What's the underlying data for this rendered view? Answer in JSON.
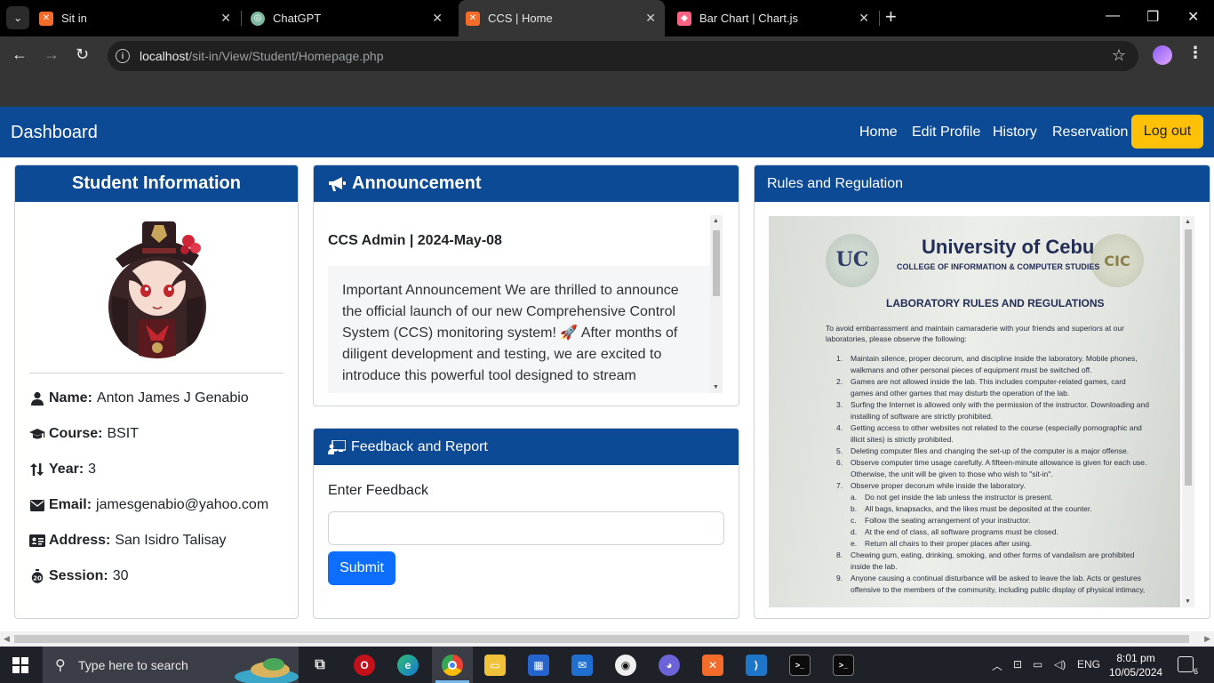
{
  "browser": {
    "tabs": [
      {
        "title": "Sit in",
        "active": false,
        "favicon": "xampp-icon"
      },
      {
        "title": "ChatGPT",
        "active": false,
        "favicon": "chatgpt-icon"
      },
      {
        "title": "CCS | Home",
        "active": true,
        "favicon": "xampp-icon"
      },
      {
        "title": "Bar Chart | Chart.js",
        "active": false,
        "favicon": "chartjs-icon"
      }
    ],
    "url_host": "localhost",
    "url_path": "/sit-in/View/Student/Homepage.php"
  },
  "navbar": {
    "brand": "Dashboard",
    "links": [
      "Home",
      "Edit Profile",
      "History",
      "Reservation"
    ],
    "logout": "Log out",
    "bg_color": "#0d4a96",
    "logout_color": "#ffc107"
  },
  "student": {
    "title": "Student Information",
    "fields": [
      {
        "label": "Name:",
        "value": "Anton James J Genabio",
        "icon": "user-icon"
      },
      {
        "label": "Course:",
        "value": "BSIT",
        "icon": "graduation-cap-icon"
      },
      {
        "label": "Year:",
        "value": "3",
        "icon": "sort-arrows-icon"
      },
      {
        "label": "Email:",
        "value": "jamesgenabio@yahoo.com",
        "icon": "envelope-icon"
      },
      {
        "label": "Address:",
        "value": "San Isidro Talisay",
        "icon": "address-card-icon"
      },
      {
        "label": "Session:",
        "value": "30",
        "icon": "stopwatch-icon"
      }
    ]
  },
  "announcement": {
    "title": "Announcement",
    "author_date": "CCS Admin | 2024-May-08",
    "body": "Important Announcement We are thrilled to announce the official launch of our new Comprehensive Control System (CCS) monitoring system! 🚀 After months of diligent development and testing, we are excited to introduce this powerful tool designed to stream"
  },
  "feedback": {
    "title": "Feedback and Report",
    "label": "Enter Feedback",
    "value": "",
    "submit": "Submit"
  },
  "rules": {
    "title": "Rules and Regulation",
    "image": {
      "university": "University of Cebu",
      "college": "COLLEGE OF INFORMATION & COMPUTER STUDIES",
      "heading": "LABORATORY RULES AND REGULATIONS",
      "intro": "To avoid embarrassment and maintain camaraderie with your friends and superiors at our laboratories, please observe the following:",
      "items": [
        {
          "num": "1.",
          "text": "Maintain silence, proper decorum, and discipline inside the laboratory. Mobile phones, walkmans and other personal pieces of equipment must be switched off."
        },
        {
          "num": "2.",
          "text": "Games are not allowed inside the lab. This includes computer-related games, card games and other games that may disturb the operation of the lab."
        },
        {
          "num": "3.",
          "text": "Surfing the Internet is allowed only with the permission of the instructor. Downloading and installing of software are strictly prohibited."
        },
        {
          "num": "4.",
          "text": "Getting access to other websites not related to the course (especially pornographic and illicit sites) is strictly prohibited."
        },
        {
          "num": "5.",
          "text": "Deleting computer files and changing the set-up of the computer is a major offense."
        },
        {
          "num": "6.",
          "text": "Observe computer time usage carefully. A fifteen-minute allowance is given for each use. Otherwise, the unit will be given to those who wish to \"sit-in\"."
        },
        {
          "num": "7.",
          "text": "Observe proper decorum while inside the laboratory."
        },
        {
          "num": "a.",
          "text": "Do not get inside the lab unless the instructor is present.",
          "sub": true
        },
        {
          "num": "b.",
          "text": "All bags, knapsacks, and the likes must be deposited at the counter.",
          "sub": true
        },
        {
          "num": "c.",
          "text": "Follow the seating arrangement of your instructor.",
          "sub": true
        },
        {
          "num": "d.",
          "text": "At the end of class, all software programs must be closed.",
          "sub": true
        },
        {
          "num": "e.",
          "text": "Return all chairs to their proper places after using.",
          "sub": true
        },
        {
          "num": "8.",
          "text": "Chewing gum, eating, drinking, smoking, and other forms of vandalism are prohibited inside the lab."
        },
        {
          "num": "9.",
          "text": "Anyone causing a continual disturbance will be asked to leave the lab. Acts or gestures offensive to the members of the community, including public display of physical intimacy,"
        }
      ]
    }
  },
  "taskbar": {
    "search_placeholder": "Type here to search",
    "language": "ENG",
    "time": "8:01 pm",
    "date": "10/05/2024",
    "notification_count": "6"
  }
}
